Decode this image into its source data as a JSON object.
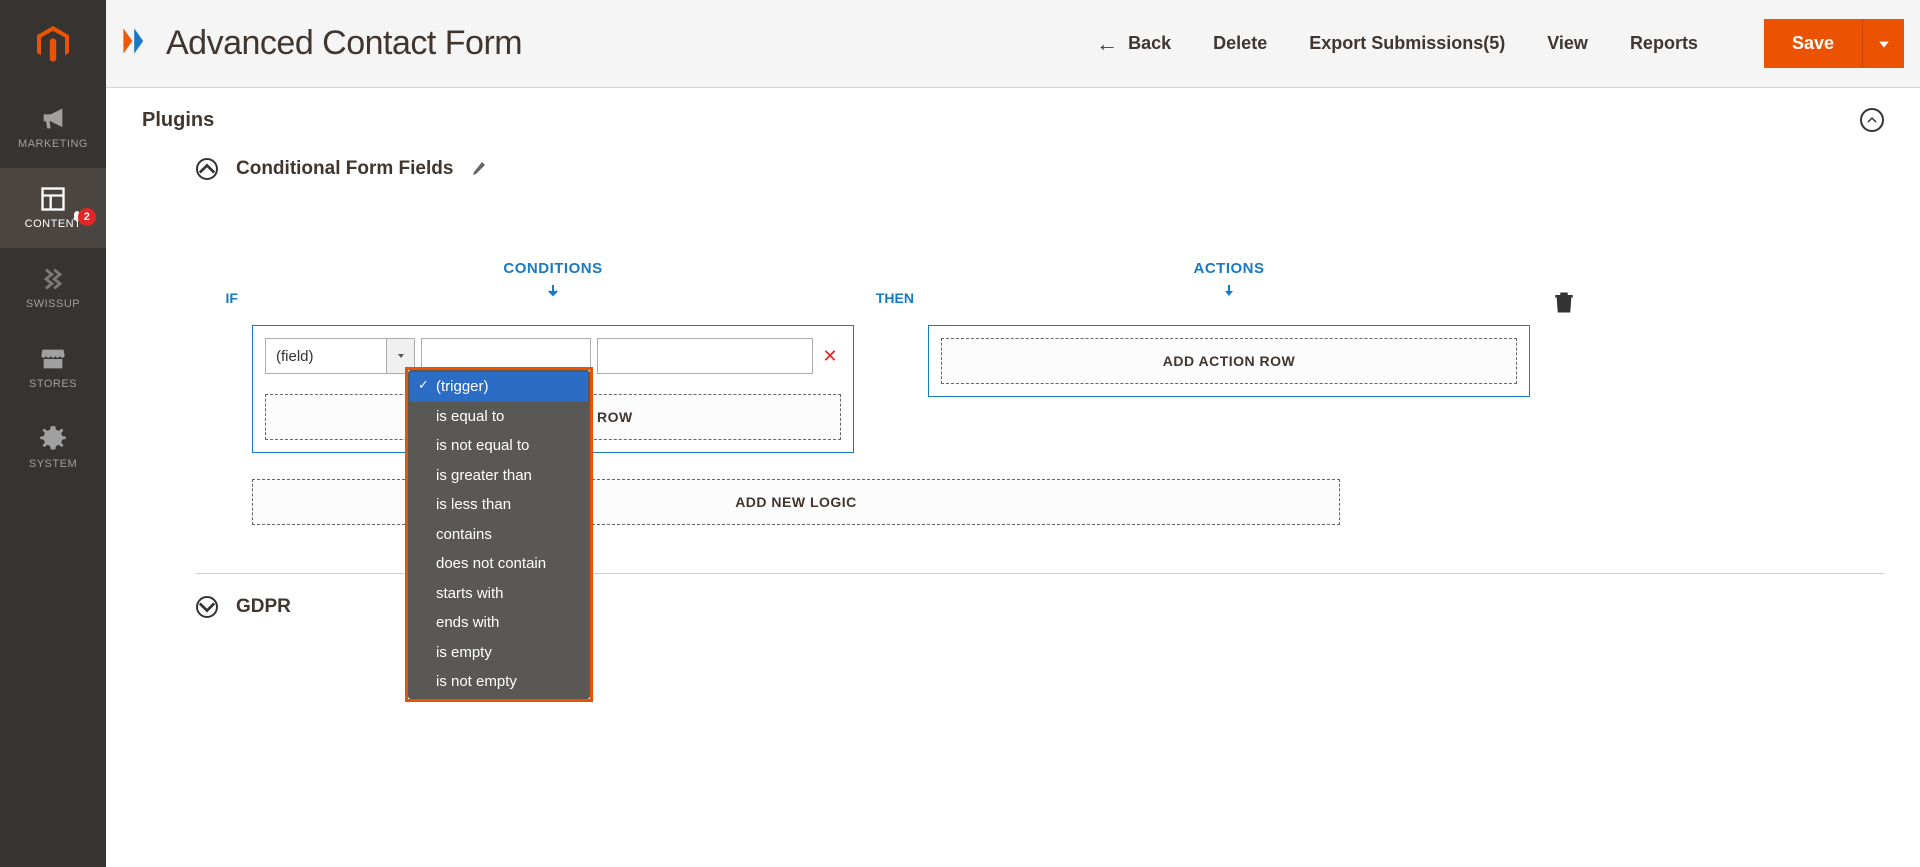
{
  "sidebar": {
    "items": [
      {
        "label": "MARKETING"
      },
      {
        "label": "CONTENT",
        "badge": "2"
      },
      {
        "label": "SWISSUP"
      },
      {
        "label": "STORES"
      },
      {
        "label": "SYSTEM"
      }
    ]
  },
  "header": {
    "title": "Advanced Contact Form",
    "back": "Back",
    "delete": "Delete",
    "export": "Export Submissions(5)",
    "view": "View",
    "reports": "Reports",
    "save": "Save"
  },
  "sections": {
    "plugins": "Plugins",
    "cff": "Conditional Form Fields",
    "gdpr": "GDPR"
  },
  "builder": {
    "conditions_label": "CONDITIONS",
    "actions_label": "ACTIONS",
    "if": "IF",
    "then": "THEN",
    "field_placeholder": "(field)",
    "add_condition_row": "ADD CONDITION ROW",
    "add_action_row": "ADD ACTION ROW",
    "add_new_logic": "ADD NEW LOGIC"
  },
  "dropdown": {
    "selected": "(trigger)",
    "options": [
      "(trigger)",
      "is equal to",
      "is not equal to",
      "is greater than",
      "is less than",
      "contains",
      "does not contain",
      "starts with",
      "ends with",
      "is empty",
      "is not empty"
    ]
  }
}
